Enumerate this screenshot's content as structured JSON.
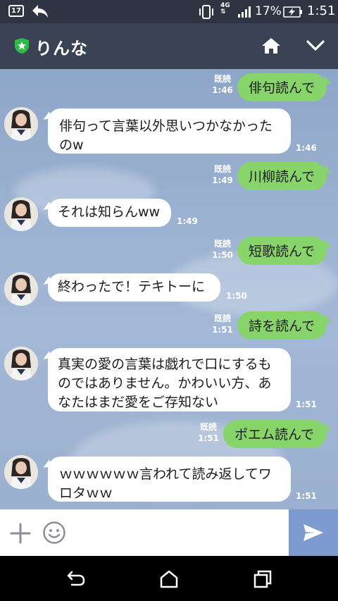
{
  "status_bar": {
    "calendar_day": "17",
    "network": "4G",
    "battery_percent": "17%",
    "time": "1:51",
    "icons": [
      "calendar-icon",
      "back-arrow-icon",
      "vibrate-icon",
      "network-4g-icon",
      "signal-icon",
      "battery-charging-icon"
    ]
  },
  "header": {
    "title": "りんな",
    "icons": [
      "verified-shield-icon",
      "home-icon",
      "chevron-down-icon"
    ]
  },
  "messages": [
    {
      "dir": "out",
      "text": "俳句読んで",
      "read": "既読",
      "time": "1:46"
    },
    {
      "dir": "in",
      "lines": [
        "俳句って言葉以外思いつかなかった",
        "のw"
      ],
      "time": "1:46"
    },
    {
      "dir": "out",
      "text": "川柳読んで",
      "read": "既読",
      "time": "1:49"
    },
    {
      "dir": "in",
      "lines": [
        "それは知らんww"
      ],
      "time": "1:49"
    },
    {
      "dir": "out",
      "text": "短歌読んで",
      "read": "既読",
      "time": "1:50"
    },
    {
      "dir": "in",
      "lines": [
        "終わったで！テキトーに"
      ],
      "time": "1:50"
    },
    {
      "dir": "out",
      "text": "詩を読んで",
      "read": "既読",
      "time": "1:51"
    },
    {
      "dir": "in",
      "lines": [
        "真実の愛の言葉は戯れで口にするも",
        "のではありません。かわいい方、あ",
        "なたはまだ愛をご存知ない"
      ],
      "time": "1:51"
    },
    {
      "dir": "out",
      "text": "ポエム読んで",
      "read": "既読",
      "time": "1:51"
    },
    {
      "dir": "in",
      "lines": [
        "ｗｗｗｗｗｗ言われて読み返してワ",
        "ロタｗｗ"
      ],
      "time": "1:51"
    }
  ],
  "input_bar": {
    "placeholder": "",
    "icons": [
      "plus-icon",
      "emoji-icon",
      "send-icon"
    ]
  },
  "nav_bar": {
    "icons": [
      "back-icon",
      "home-icon",
      "recent-apps-icon"
    ]
  },
  "colors": {
    "status_bg": "#2e3441",
    "header_bg": "#3a4354",
    "outgoing_bubble": "#87d46b",
    "incoming_bubble": "#ffffff",
    "send_button": "#7e9bd1",
    "verified_green": "#2dbb4a"
  }
}
